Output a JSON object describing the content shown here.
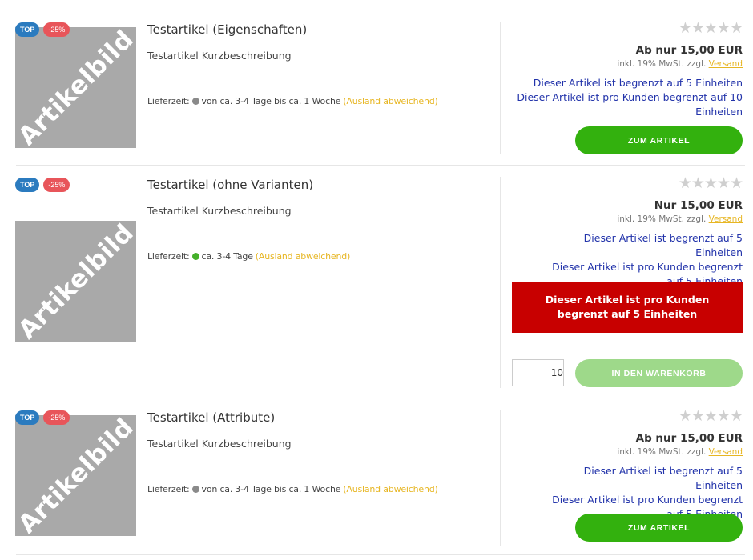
{
  "products": [
    {
      "image_watermark": "Artikelbild",
      "badge_top": "TOP",
      "badge_discount": "-25%",
      "title": "Testartikel (Eigenschaften)",
      "short_description": "Testartikel Kurzbeschreibung",
      "delivery_label": "Lieferzeit:",
      "delivery_status_color": "#8a8a8a",
      "delivery_time": "von ca. 3-4 Tage bis ca. 1 Woche",
      "delivery_abroad": "(Ausland abweichend)",
      "rating": "★★★★★",
      "price": "Ab nur 15,00 EUR",
      "tax_text": "inkl. 19% MwSt. zzgl.",
      "shipping_link": "Versand",
      "limit_line_1": "Dieser Artikel ist begrenzt auf 5 Einheiten",
      "limit_line_2": "Dieser Artikel ist pro Kunden begrenzt auf 10 Einheiten",
      "button_label": "ZUM ARTIKEL"
    },
    {
      "image_watermark": "Artikelbild",
      "badge_top": "TOP",
      "badge_discount": "-25%",
      "title": "Testartikel (ohne Varianten)",
      "short_description": "Testartikel Kurzbeschreibung",
      "delivery_label": "Lieferzeit:",
      "delivery_status_color": "#44b02a",
      "delivery_time": "ca. 3-4 Tage",
      "delivery_abroad": "(Ausland abweichend)",
      "rating": "★★★★★",
      "price": "Nur 15,00 EUR",
      "tax_text": "inkl. 19% MwSt. zzgl.",
      "shipping_link": "Versand",
      "limit_line_1": "Dieser Artikel ist begrenzt auf 5 Einheiten",
      "limit_line_2": "Dieser Artikel ist pro Kunden begrenzt auf 5 Einheiten",
      "alert_message": "Dieser Artikel ist pro Kunden begrenzt auf 5 Einheiten",
      "quantity_value": "10",
      "button_label": "IN DEN WARENKORB"
    },
    {
      "image_watermark": "Artikelbild",
      "badge_top": "TOP",
      "badge_discount": "-25%",
      "title": "Testartikel (Attribute)",
      "short_description": "Testartikel Kurzbeschreibung",
      "delivery_label": "Lieferzeit:",
      "delivery_status_color": "#8a8a8a",
      "delivery_time": "von ca. 3-4 Tage bis ca. 1 Woche",
      "delivery_abroad": "(Ausland abweichend)",
      "rating": "★★★★★",
      "price": "Ab nur 15,00 EUR",
      "tax_text": "inkl. 19% MwSt. zzgl.",
      "shipping_link": "Versand",
      "limit_line_1": "Dieser Artikel ist begrenzt auf 5 Einheiten",
      "limit_line_2": "Dieser Artikel ist pro Kunden begrenzt auf 5 Einheiten",
      "button_label": "ZUM ARTIKEL"
    }
  ],
  "colors": {
    "primary_button": "#33b10e",
    "disabled_button": "#9ed98a",
    "alert_background": "#c80000",
    "limit_text": "#2233aa",
    "abroad_text": "#e7b623",
    "badge_top": "#2b7bbf",
    "badge_discount": "#e8555a"
  }
}
